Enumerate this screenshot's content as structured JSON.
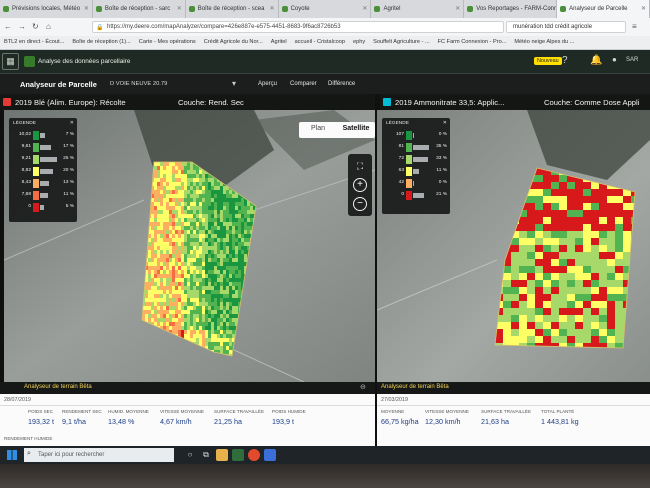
{
  "browser": {
    "tabs": [
      {
        "label": "Prévisions locales, Météo",
        "active": false
      },
      {
        "label": "Boîte de réception - sarc",
        "active": false
      },
      {
        "label": "Boîte de réception - scea",
        "active": false
      },
      {
        "label": "Coyote",
        "active": false
      },
      {
        "label": "Agritel",
        "active": false
      },
      {
        "label": "Vos Reportages - FARM-Conne",
        "active": false
      },
      {
        "label": "Analyseur de Parcelle",
        "active": true
      }
    ],
    "url": "https://my.deere.com/mapAnalyzer/compare=426e887e-e575-4451-8683-9f6ac8726b53",
    "search_value": "munération tdd crédit agricole",
    "bookmarks": [
      "BTL2 en direct - Écout...",
      "Boîte de réception (1)...",
      "Carte - Mes opérations",
      "Crédit Agricole du Nor...",
      "Agritel",
      "accueil - Cristalcoop",
      "ephy",
      "Souffelt Agriculture - ...",
      "FC Farm Connexion - Pro...",
      "Météo neige Alpes du ..."
    ]
  },
  "app": {
    "title": "Analyse des données parcellaire",
    "new_badge": "Nouveau",
    "user_initials": "SAR"
  },
  "analyzer": {
    "title": "Analyseur de Parcelle",
    "field_name": "D VOIE NEUVE 20.79",
    "nav": [
      "Aperçu",
      "Comparer",
      "Différence"
    ]
  },
  "colors": {
    "harvest_swatch": "#e53935",
    "application_swatch": "#00bcd4",
    "stats_value": "#1f3d8a",
    "analysis_link": "#f3d35a"
  },
  "left_panel": {
    "layer_name": "2019 Blé (Alim. Europe): Récolte",
    "layer_type": "Couche: Rend. Sec",
    "legend_title": "LÉGENDE",
    "legend": [
      {
        "value": "10,02",
        "pct": "7 %",
        "color": "#1a9641",
        "frac": 0.28
      },
      {
        "value": "9,61",
        "pct": "17 %",
        "color": "#52b351",
        "frac": 0.62
      },
      {
        "value": "9,21",
        "pct": "25 %",
        "color": "#a6d96a",
        "frac": 0.92
      },
      {
        "value": "8,82",
        "pct": "20 %",
        "color": "#ffff66",
        "frac": 0.74
      },
      {
        "value": "8,43",
        "pct": "13 %",
        "color": "#fdae61",
        "frac": 0.5
      },
      {
        "value": "7,68",
        "pct": "11 %",
        "color": "#f46d43",
        "frac": 0.42
      },
      {
        "value": "0",
        "pct": "5 %",
        "color": "#d7191c",
        "frac": 0.2
      }
    ],
    "basemap": {
      "plan": "Plan",
      "satellite": "Satellite"
    },
    "analysis_link": "Analyseur de terrain Bêta",
    "date": "28/07/2019",
    "stats": [
      {
        "label": "POIDS SEC",
        "value": "193,32 t"
      },
      {
        "label": "RENDEMENT SEC",
        "value": "9,1 t/ha"
      },
      {
        "label": "HUMID. MOYENNE",
        "value": "13,48 %"
      },
      {
        "label": "VITESSE MOYENNE",
        "value": "4,67 km/h"
      },
      {
        "label": "SURFACE TRAVAILLÉE",
        "value": "21,25 ha"
      },
      {
        "label": "POIDS HUMIDE",
        "value": "193,9 t"
      }
    ],
    "extra_label": "RENDEMENT HUMIDE"
  },
  "right_panel": {
    "layer_name": "2019 Ammonitrate 33,5: Applic...",
    "layer_type": "Couche: Comme Dose Appli",
    "legend_title": "LÉGENDE",
    "legend": [
      {
        "value": "107",
        "pct": "0 %",
        "color": "#1a9641",
        "frac": 0.02
      },
      {
        "value": "81",
        "pct": "35 %",
        "color": "#52b351",
        "frac": 0.9
      },
      {
        "value": "72",
        "pct": "33 %",
        "color": "#a6d96a",
        "frac": 0.85
      },
      {
        "value": "63",
        "pct": "11 %",
        "color": "#ffff66",
        "frac": 0.35
      },
      {
        "value": "42",
        "pct": "0 %",
        "color": "#fdae61",
        "frac": 0.02
      },
      {
        "value": "0",
        "pct": "21 %",
        "color": "#d7191c",
        "frac": 0.6
      }
    ],
    "analysis_link": "Analyseur de terrain Bêta",
    "date": "27/03/2019",
    "stats": [
      {
        "label": "MOYENNE",
        "value": "66,75 kg/ha"
      },
      {
        "label": "VITESSE MOYENNE",
        "value": "12,30 km/h"
      },
      {
        "label": "SURFACE TRAVAILLÉE",
        "value": "21,63 ha"
      },
      {
        "label": "TOTAL PLANTÉ",
        "value": "1 443,81 kg"
      }
    ]
  },
  "taskbar": {
    "search_placeholder": "Taper ici pour rechercher"
  }
}
